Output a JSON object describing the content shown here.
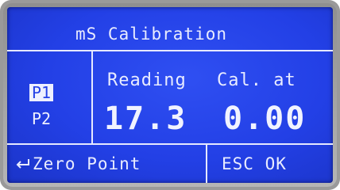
{
  "screen": {
    "title": "mS Calibration",
    "points": [
      "P1",
      "P2"
    ],
    "selected_point": "P1",
    "columns": {
      "reading_label": "Reading",
      "cal_label": "Cal. at"
    },
    "values": {
      "reading": "17.3",
      "cal_at": "0.00"
    },
    "footer": {
      "left_label": "Zero Point",
      "left_icon": "enter-arrow-icon",
      "right_label": "ESC OK"
    }
  },
  "colors": {
    "lcd_background": "#2340e6",
    "lcd_text": "#e9ecff",
    "bezel": "#9a9a9a"
  }
}
